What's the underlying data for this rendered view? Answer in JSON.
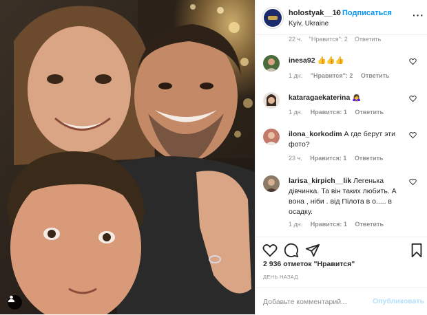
{
  "header": {
    "username": "holostyak__10",
    "separator": "•",
    "follow_label": "Подписаться",
    "location": "Kyiv, Ukraine",
    "more_icon": "more-horizontal-icon"
  },
  "previous_comment_meta": {
    "time": "22 ч.",
    "likes": "\"Нравится\": 2",
    "reply": "Ответить"
  },
  "comments": [
    {
      "username": "inesa92",
      "text": "👍👍👍",
      "time": "1 дн.",
      "likes": "\"Нравится\": 2",
      "reply": "Ответить",
      "avatar_color": "#4a6b3a"
    },
    {
      "username": "kataragaekaterina",
      "text": "🙇‍♀️",
      "time": "1 дн.",
      "likes": "Нравится: 1",
      "reply": "Ответить",
      "avatar_color": "#7a6a5c"
    },
    {
      "username": "ilona_korkodim",
      "text": "А где берут эти фото?",
      "time": "23 ч.",
      "likes": "Нравится: 1",
      "reply": "Ответить",
      "avatar_color": "#c27a6a"
    },
    {
      "username": "larisa_kirpich__lik",
      "text": "Легенька дівчинка. Та він таких любить. А вона , ніби . від Пілота в о..... в осадку.",
      "time": "1 дн.",
      "likes": "Нравится: 1",
      "reply": "Ответить",
      "avatar_color": "#8a7a66"
    }
  ],
  "actions": {
    "like_icon": "heart-icon",
    "comment_icon": "comment-bubble-icon",
    "share_icon": "paper-plane-icon",
    "save_icon": "bookmark-icon"
  },
  "likes_text": "2 936 отметок \"Нравится\"",
  "date_text": "ДЕНЬ НАЗАД",
  "add_comment": {
    "placeholder": "Добавьте комментарий...",
    "publish_label": "Опубликовать"
  },
  "colors": {
    "link_blue": "#0095f6",
    "publish_disabled": "#b2dffc",
    "meta_gray": "#8e8e8e",
    "text": "#262626",
    "border": "#efefef"
  }
}
